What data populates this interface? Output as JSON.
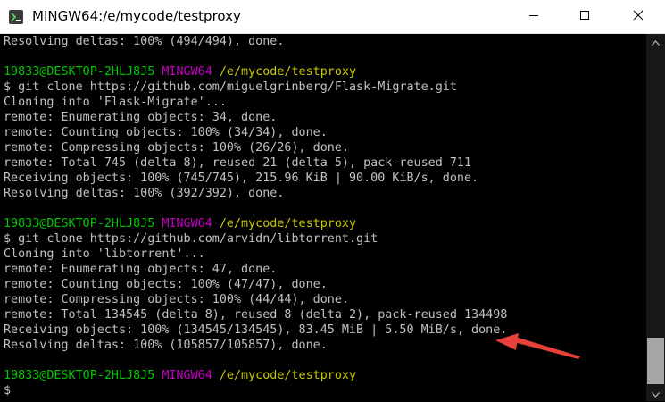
{
  "window": {
    "title": "MINGW64:/e/mycode/testproxy"
  },
  "terminal": {
    "prompt": {
      "user_host": "19833@DESKTOP-2HLJ8J5",
      "shell": "MINGW64",
      "path": "/e/mycode/testproxy"
    },
    "lines": [
      {
        "kind": "out",
        "text": "Resolving deltas: 100% (494/494), done."
      },
      {
        "kind": "blank",
        "text": ""
      },
      {
        "kind": "prompt"
      },
      {
        "kind": "out",
        "text": "$ git clone https://github.com/miguelgrinberg/Flask-Migrate.git"
      },
      {
        "kind": "out",
        "text": "Cloning into 'Flask-Migrate'..."
      },
      {
        "kind": "out",
        "text": "remote: Enumerating objects: 34, done."
      },
      {
        "kind": "out",
        "text": "remote: Counting objects: 100% (34/34), done."
      },
      {
        "kind": "out",
        "text": "remote: Compressing objects: 100% (26/26), done."
      },
      {
        "kind": "out",
        "text": "remote: Total 745 (delta 8), reused 21 (delta 5), pack-reused 711"
      },
      {
        "kind": "out",
        "text": "Receiving objects: 100% (745/745), 215.96 KiB | 90.00 KiB/s, done."
      },
      {
        "kind": "out",
        "text": "Resolving deltas: 100% (392/392), done."
      },
      {
        "kind": "blank",
        "text": ""
      },
      {
        "kind": "prompt"
      },
      {
        "kind": "out",
        "text": "$ git clone https://github.com/arvidn/libtorrent.git"
      },
      {
        "kind": "out",
        "text": "Cloning into 'libtorrent'..."
      },
      {
        "kind": "out",
        "text": "remote: Enumerating objects: 47, done."
      },
      {
        "kind": "out",
        "text": "remote: Counting objects: 100% (47/47), done."
      },
      {
        "kind": "out",
        "text": "remote: Compressing objects: 100% (44/44), done."
      },
      {
        "kind": "out",
        "text": "remote: Total 134545 (delta 8), reused 8 (delta 2), pack-reused 134498"
      },
      {
        "kind": "out",
        "text": "Receiving objects: 100% (134545/134545), 83.45 MiB | 5.50 MiB/s, done."
      },
      {
        "kind": "out",
        "text": "Resolving deltas: 100% (105857/105857), done."
      },
      {
        "kind": "blank",
        "text": ""
      },
      {
        "kind": "prompt"
      },
      {
        "kind": "input",
        "text": "$"
      }
    ]
  },
  "colors": {
    "background": "#000000",
    "text": "#c0c0c0",
    "user_host": "#00c800",
    "shell": "#c000c0",
    "path": "#c8c800",
    "annotation_arrow": "#e8403a"
  }
}
